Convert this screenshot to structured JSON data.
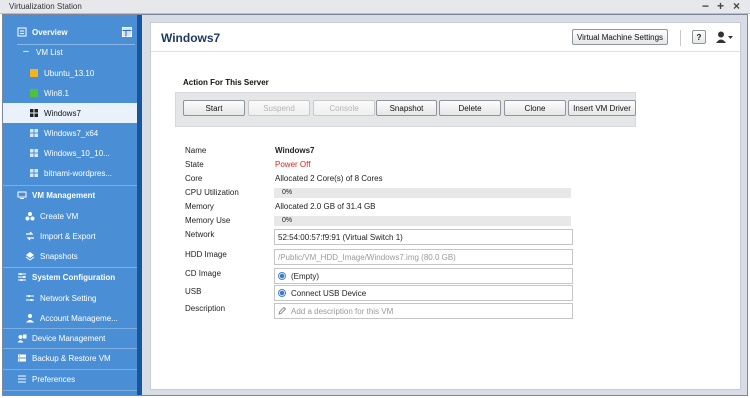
{
  "window": {
    "title": "Virtualization Station"
  },
  "sidebar": {
    "overview": "Overview",
    "vm_list": "VM List",
    "vms": [
      "Ubuntu_13.10",
      "Win8.1",
      "Windows7",
      "Windows7_x64",
      "Windows_10_10...",
      "bitnami-wordpres..."
    ],
    "vm_management": "VM Management",
    "create_vm": "Create VM",
    "import_export": "Import & Export",
    "snapshots": "Snapshots",
    "system_configuration": "System Configuration",
    "network_setting": "Network Setting",
    "account_management": "Account Manageme...",
    "device_management": "Device Management",
    "backup_restore": "Backup & Restore VM",
    "preferences": "Preferences"
  },
  "header": {
    "vm_name": "Windows7",
    "settings_button": "Virtual Machine Settings",
    "help_label": "?"
  },
  "actions": {
    "section_title": "Action For This Server",
    "buttons": [
      "Start",
      "Suspend",
      "Console",
      "Snapshot",
      "Delete",
      "Clone",
      "Insert VM Driver"
    ]
  },
  "properties": {
    "name_label": "Name",
    "name_value": "Windows7",
    "state_label": "State",
    "state_value": "Power Off",
    "core_label": "Core",
    "core_value": "Allocated 2 Core(s) of 8 Cores",
    "cpu_label": "CPU Utilization",
    "cpu_value": "0%",
    "memory_label": "Memory",
    "memory_value": "Allocated 2.0 GB of 31.4 GB",
    "memory_use_label": "Memory Use",
    "memory_use_value": "0%",
    "network_label": "Network",
    "network_value": "52:54:00:57:f9:91 (Virtual Switch 1)",
    "hdd_label": "HDD Image",
    "hdd_value": "/Public/VM_HDD_Image/Windows7.img (80.0 GB)",
    "cd_label": "CD Image",
    "cd_value": "(Empty)",
    "usb_label": "USB",
    "usb_value": "Connect USB Device",
    "description_label": "Description",
    "description_placeholder": "Add a description for this VM"
  },
  "colors": {
    "sidebar": "#4a8fd6",
    "sidebar_scroll": "#17559d",
    "state_off": "#e02020",
    "title": "#1f3a66"
  }
}
